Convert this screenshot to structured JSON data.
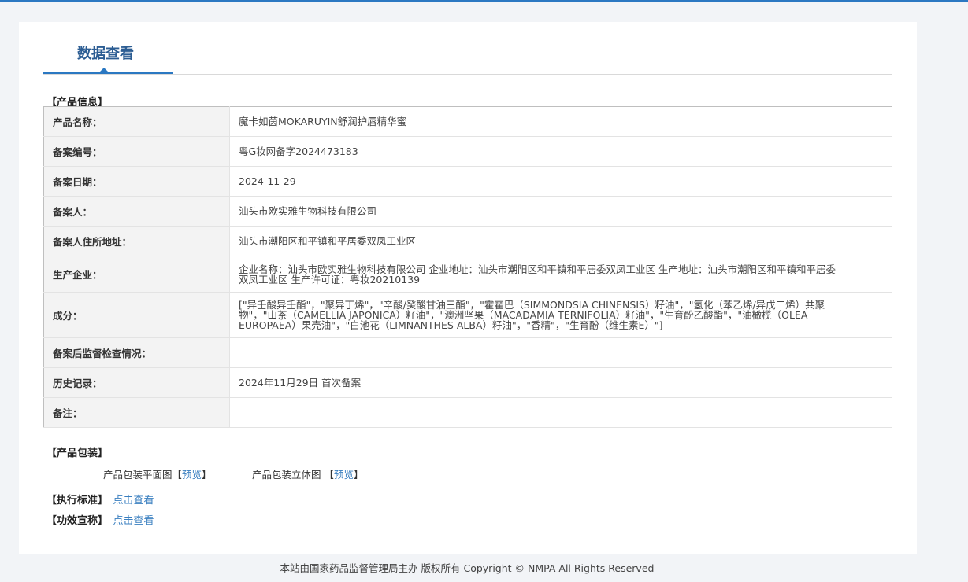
{
  "tab": {
    "title": "数据查看"
  },
  "sections": {
    "product_info": "【产品信息】",
    "packaging": "【产品包装】",
    "standard": "【执行标准】",
    "efficacy": "【功效宣称】"
  },
  "product_info": {
    "rows": [
      {
        "label": "产品名称：",
        "value": "魔卡如茵MOKARUYIN舒润护唇精华蜜"
      },
      {
        "label": "备案编号：",
        "value": "粤G妆网备字2024473183"
      },
      {
        "label": "备案日期：",
        "value": "2024-11-29"
      },
      {
        "label": "备案人：",
        "value": "汕头市欧实雅生物科技有限公司"
      },
      {
        "label": "备案人住所地址：",
        "value": "汕头市潮阳区和平镇和平居委双凤工业区"
      },
      {
        "label": "生产企业：",
        "value": "企业名称：汕头市欧实雅生物科技有限公司 企业地址：汕头市潮阳区和平镇和平居委双凤工业区 生产地址：汕头市潮阳区和平镇和平居委双凤工业区 生产许可证：粤妆20210139"
      },
      {
        "label": "成分：",
        "value": "[\"异壬酸异壬酯\"，\"聚异丁烯\"，\"辛酸/癸酸甘油三酯\"，\"霍霍巴（SIMMONDSIA CHINENSIS）籽油\"，\"氢化（苯乙烯/异戊二烯）共聚物\"，\"山茶（CAMELLIA JAPONICA）籽油\"，\"澳洲坚果（MACADAMIA TERNIFOLIA）籽油\"，\"生育酚乙酸酯\"，\"油橄榄（OLEA EUROPAEA）果壳油\"，\"白池花（LIMNANTHES ALBA）籽油\"，\"香精\"，\"生育酚（维生素E）\"]"
      },
      {
        "label": "备案后监督检查情况：",
        "value": ""
      },
      {
        "label": "历史记录：",
        "value": "2024年11月29日 首次备案"
      },
      {
        "label": "备注：",
        "value": ""
      }
    ]
  },
  "packaging": {
    "flat_label": "产品包装平面图",
    "flat_link": "预览",
    "solid_label": "产品包装立体图",
    "solid_link": "预览"
  },
  "standard": {
    "link": "点击查看"
  },
  "efficacy": {
    "link": "点击查看"
  },
  "footer": {
    "text": "本站由国家药品监督管理局主办 版权所有 Copyright © NMPA All Rights Reserved"
  },
  "colors": {
    "accent": "#2b78c2",
    "link": "#3a7fc0",
    "title": "#2c5d93"
  }
}
